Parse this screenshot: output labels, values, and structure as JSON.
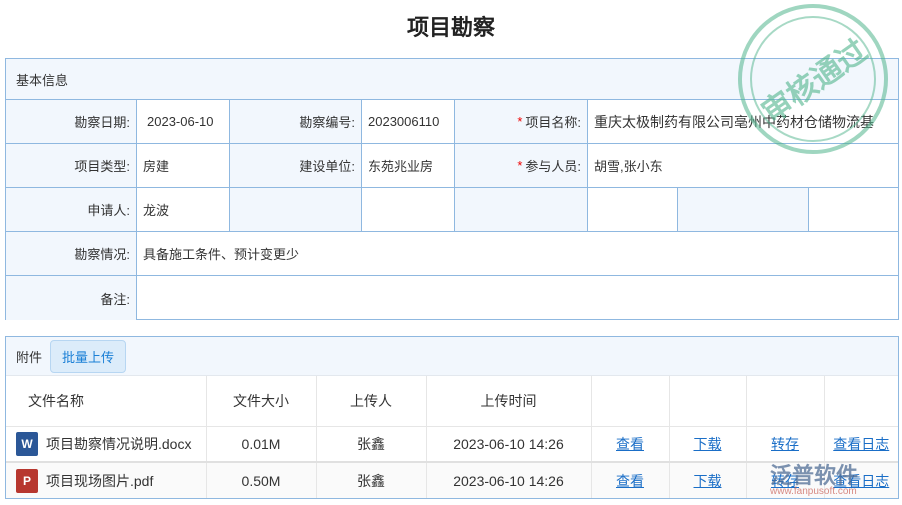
{
  "title": "项目勘察",
  "info": {
    "section": "基本信息",
    "survey_date_label": "勘察日期:",
    "survey_date": "2023-06-10",
    "survey_no_label": "勘察编号:",
    "survey_no": "2023006110",
    "project_name_label": "项目名称:",
    "project_name": "重庆太极制药有限公司亳州中药材仓储物流基",
    "project_type_label": "项目类型:",
    "project_type": "房建",
    "builder_label": "建设单位:",
    "builder": "东苑兆业房",
    "participants_label": "参与人员:",
    "participants": "胡雪,张小东",
    "applicant_label": "申请人:",
    "applicant": "龙波",
    "situation_label": "勘察情况:",
    "situation": "具备施工条件、预计变更少",
    "remark_label": "备注:",
    "remark": ""
  },
  "attachments": {
    "section": "附件",
    "upload_button": "批量上传",
    "headers": [
      "文件名称",
      "文件大小",
      "上传人",
      "上传时间"
    ],
    "rows": [
      {
        "name": "项目勘察情况说明.docx",
        "type": "word",
        "size": "0.01M",
        "uploader": "张鑫",
        "time": "2023-06-10 14:26",
        "view": "查看",
        "download": "下载",
        "save": "转存",
        "log": "查看日志"
      },
      {
        "name": "项目现场图片.pdf",
        "type": "pdf",
        "size": "0.50M",
        "uploader": "张鑫",
        "time": "2023-06-10 14:26",
        "view": "查看",
        "download": "下载",
        "save": "转存",
        "log": "查看日志"
      }
    ]
  },
  "stamp": "审核通过",
  "watermark": {
    "brand": "泛普软件",
    "url": "www.fanpusoft.com"
  },
  "colors": {
    "border": "#8fb8e0",
    "label_bg": "#f2f7fd",
    "link": "#1a6ec7",
    "required": "#e00000"
  }
}
